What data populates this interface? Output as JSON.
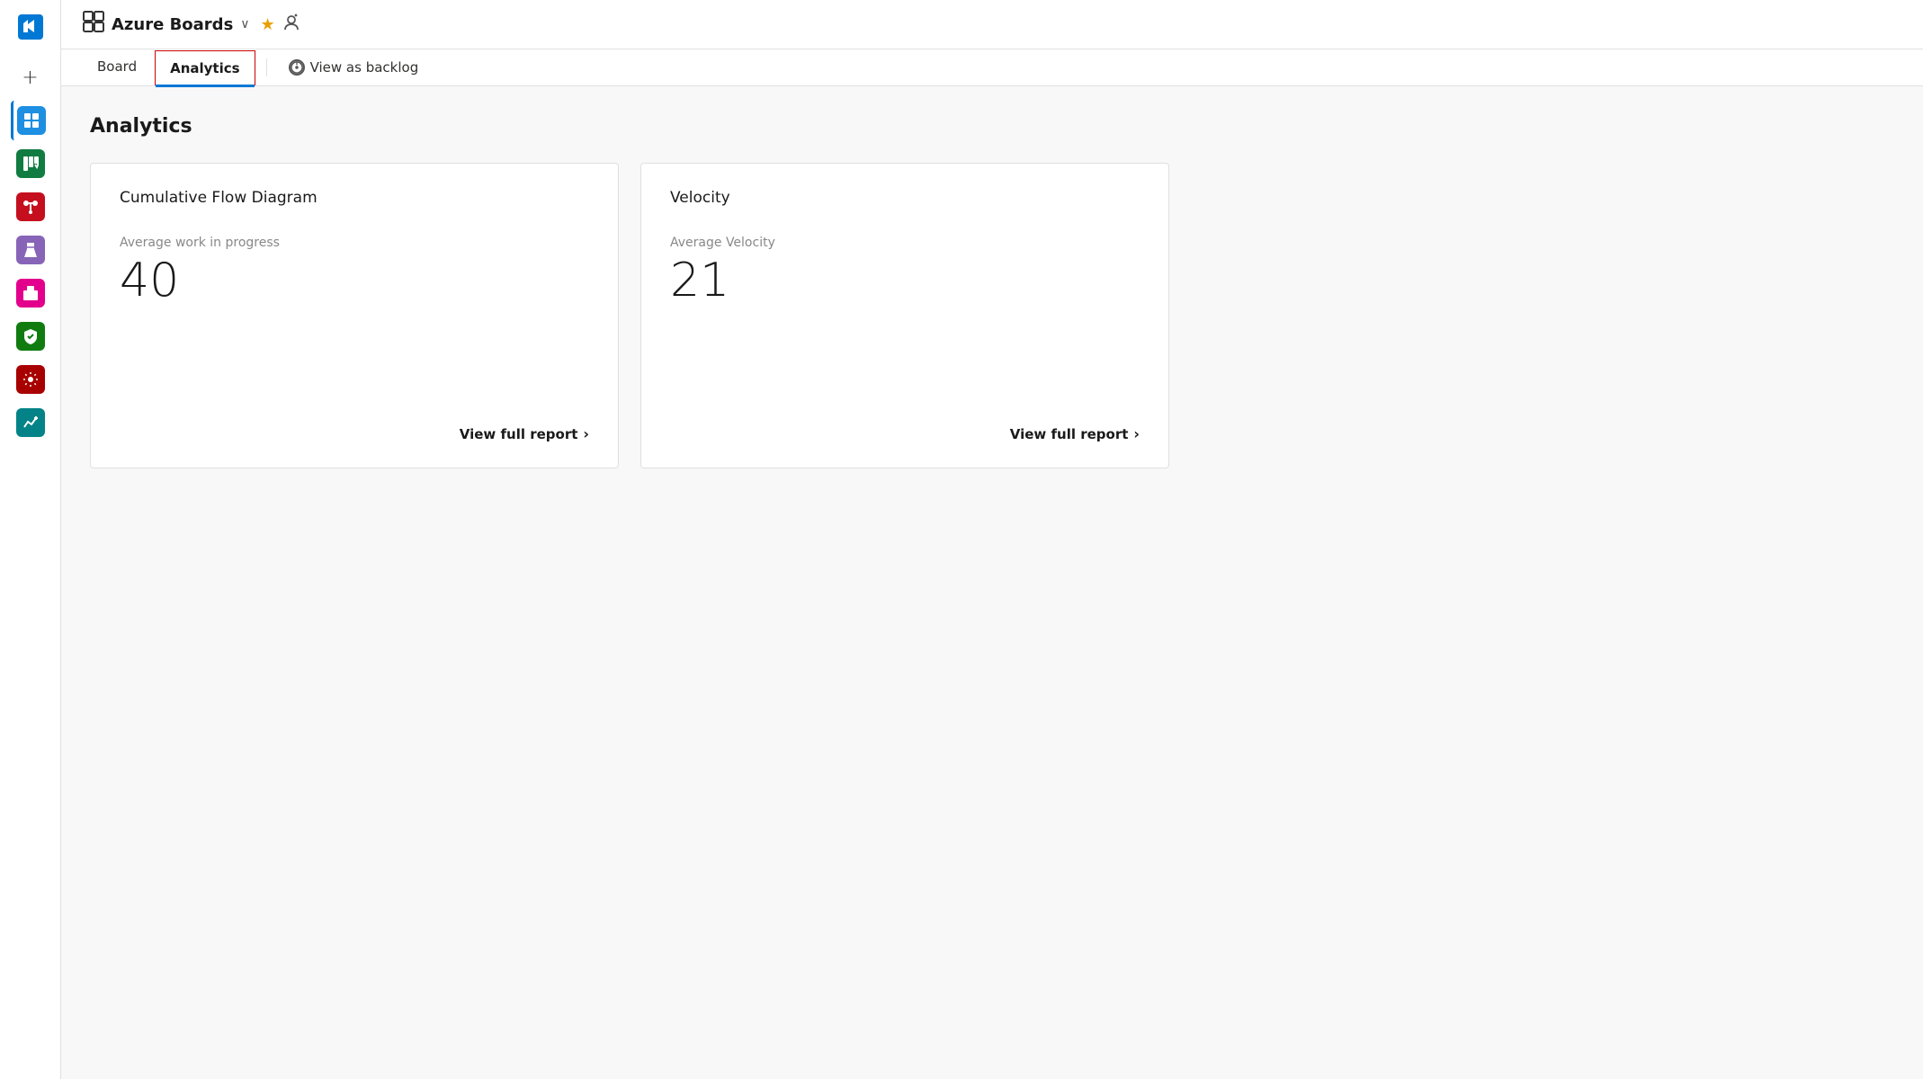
{
  "app": {
    "title": "Azure Boards",
    "logo_icon": "🗃",
    "star_icon": "★",
    "person_icon": "👤",
    "chevron": "∨"
  },
  "nav": {
    "board_tab": "Board",
    "analytics_tab": "Analytics",
    "view_as_backlog": "View as backlog"
  },
  "page": {
    "title": "Analytics"
  },
  "cards": [
    {
      "id": "cumulative-flow",
      "title": "Cumulative Flow Diagram",
      "metric_label": "Average work in progress",
      "metric_value": "40",
      "link_label": "View full report"
    },
    {
      "id": "velocity",
      "title": "Velocity",
      "metric_label": "Average Velocity",
      "metric_value": "21",
      "link_label": "View full report"
    }
  ],
  "sidebar": {
    "icons": [
      {
        "name": "azure-devops-logo",
        "symbol": "◈",
        "color": "#0078d4"
      },
      {
        "name": "plus-icon",
        "symbol": "+",
        "color": "#333"
      },
      {
        "name": "boards-icon",
        "symbol": "⊞",
        "bg": "#0078d4"
      },
      {
        "name": "kanban-icon",
        "symbol": "▦",
        "bg": "#107c10"
      },
      {
        "name": "pipelines-icon",
        "symbol": "⬡",
        "bg": "#c50f1f"
      },
      {
        "name": "test-icon",
        "symbol": "⚗",
        "bg": "#8764b8"
      },
      {
        "name": "artifacts-icon",
        "symbol": "⬛",
        "bg": "#e3008c"
      },
      {
        "name": "security-icon",
        "symbol": "⛨",
        "bg": "#107c10"
      },
      {
        "name": "settings-icon",
        "symbol": "◎",
        "bg": "#a80000"
      },
      {
        "name": "analytics-icon",
        "symbol": "↗",
        "bg": "#038387"
      }
    ]
  }
}
